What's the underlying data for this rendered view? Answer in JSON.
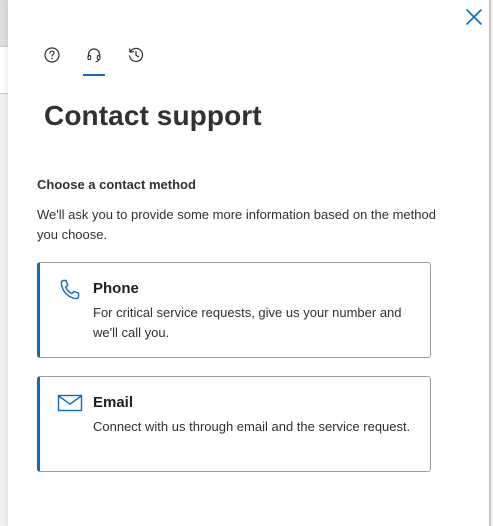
{
  "panel": {
    "close_icon": "close-icon"
  },
  "tabs": [
    {
      "name": "help",
      "icon": "help-circle-icon",
      "active": false
    },
    {
      "name": "contact-support",
      "icon": "headset-icon",
      "active": true
    },
    {
      "name": "history",
      "icon": "history-icon",
      "active": false
    }
  ],
  "page": {
    "title": "Contact support",
    "subheading": "Choose a contact method",
    "description": "We'll ask you to provide some more information based on the method you choose."
  },
  "methods": [
    {
      "id": "phone",
      "icon": "phone-icon",
      "title": "Phone",
      "description": "For critical service requests, give us your number and we'll call you."
    },
    {
      "id": "email",
      "icon": "mail-icon",
      "title": "Email",
      "description": "Connect with us through email and the service request."
    }
  ],
  "colors": {
    "accent": "#0f6cbd",
    "text": "#323130",
    "border": "#a19f9d"
  }
}
